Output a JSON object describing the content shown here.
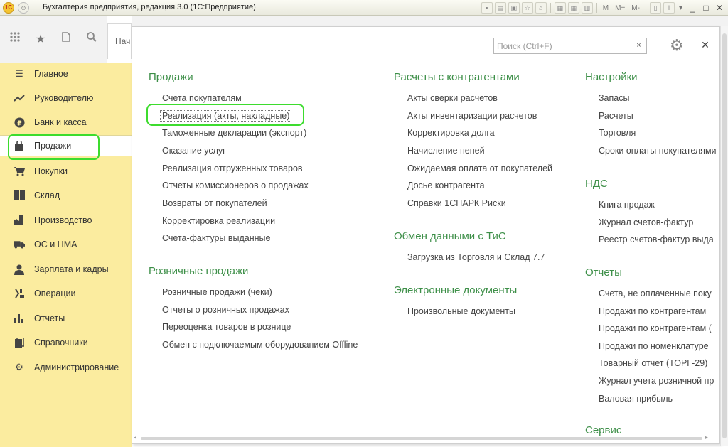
{
  "window": {
    "title": "Бухгалтерия предприятия, редакция 3.0  (1С:Предприятие)",
    "logo": "1С",
    "toolbar_m": "M",
    "toolbar_mplus": "M+",
    "toolbar_mminus": "M-",
    "toolbar_info": "i"
  },
  "tabs": {
    "start": "Нач"
  },
  "search": {
    "placeholder": "Поиск (Ctrl+F)",
    "clear": "×"
  },
  "sidebar": {
    "items": [
      {
        "label": "Главное",
        "icon": "menu-lines-icon"
      },
      {
        "label": "Руководителю",
        "icon": "trend-icon"
      },
      {
        "label": "Банк и касса",
        "icon": "ruble-coin-icon"
      },
      {
        "label": "Продажи",
        "icon": "shopping-bag-icon",
        "active": true
      },
      {
        "label": "Покупки",
        "icon": "cart-icon"
      },
      {
        "label": "Склад",
        "icon": "warehouse-icon"
      },
      {
        "label": "Производство",
        "icon": "factory-icon"
      },
      {
        "label": "ОС и НМА",
        "icon": "truck-icon"
      },
      {
        "label": "Зарплата и кадры",
        "icon": "person-icon"
      },
      {
        "label": "Операции",
        "icon": "operations-icon"
      },
      {
        "label": "Отчеты",
        "icon": "bar-chart-icon"
      },
      {
        "label": "Справочники",
        "icon": "book-icon"
      },
      {
        "label": "Администрирование",
        "icon": "gear-icon"
      }
    ]
  },
  "panel": {
    "col1": {
      "sec1": {
        "title": "Продажи",
        "links": [
          "Счета покупателям",
          "Реализация (акты, накладные)",
          "Таможенные декларации (экспорт)",
          "Оказание услуг",
          "Реализация отгруженных товаров",
          "Отчеты комиссионеров о продажах",
          "Возвраты от покупателей",
          "Корректировка реализации",
          "Счета-фактуры выданные"
        ]
      },
      "sec2": {
        "title": "Розничные продажи",
        "links": [
          "Розничные продажи (чеки)",
          "Отчеты о розничных продажах",
          "Переоценка товаров в рознице",
          "Обмен с подключаемым оборудованием Offline"
        ]
      }
    },
    "col2": {
      "sec1": {
        "title": "Расчеты с контрагентами",
        "links": [
          "Акты сверки расчетов",
          "Акты инвентаризации расчетов",
          "Корректировка долга",
          "Начисление пеней",
          "Ожидаемая оплата от покупателей",
          "Досье контрагента",
          "Справки 1СПАРК Риски"
        ]
      },
      "sec2": {
        "title": "Обмен данными с ТиС",
        "links": [
          "Загрузка из Торговля и Склад 7.7"
        ]
      },
      "sec3": {
        "title": "Электронные документы",
        "links": [
          "Произвольные документы"
        ]
      }
    },
    "col3": {
      "sec1": {
        "title": "Настройки",
        "links": [
          "Запасы",
          "Расчеты",
          "Торговля",
          "Сроки оплаты покупателями"
        ]
      },
      "sec2": {
        "title": "НДС",
        "links": [
          "Книга продаж",
          "Журнал счетов-фактур",
          "Реестр счетов-фактур выда"
        ]
      },
      "sec3": {
        "title": "Отчеты",
        "links": [
          "Счета, не оплаченные поку",
          "Продажи по контрагентам",
          "Продажи по контрагентам (",
          "Продажи по номенклатуре",
          "Товарный отчет (ТОРГ-29)",
          "Журнал учета розничной пр",
          "Валовая прибыль"
        ]
      },
      "sec4": {
        "title": "Сервис"
      }
    }
  },
  "colors": {
    "sidebar_bg": "#fbec9f",
    "section_title": "#3d8f48",
    "highlight": "#3ddc2e"
  }
}
